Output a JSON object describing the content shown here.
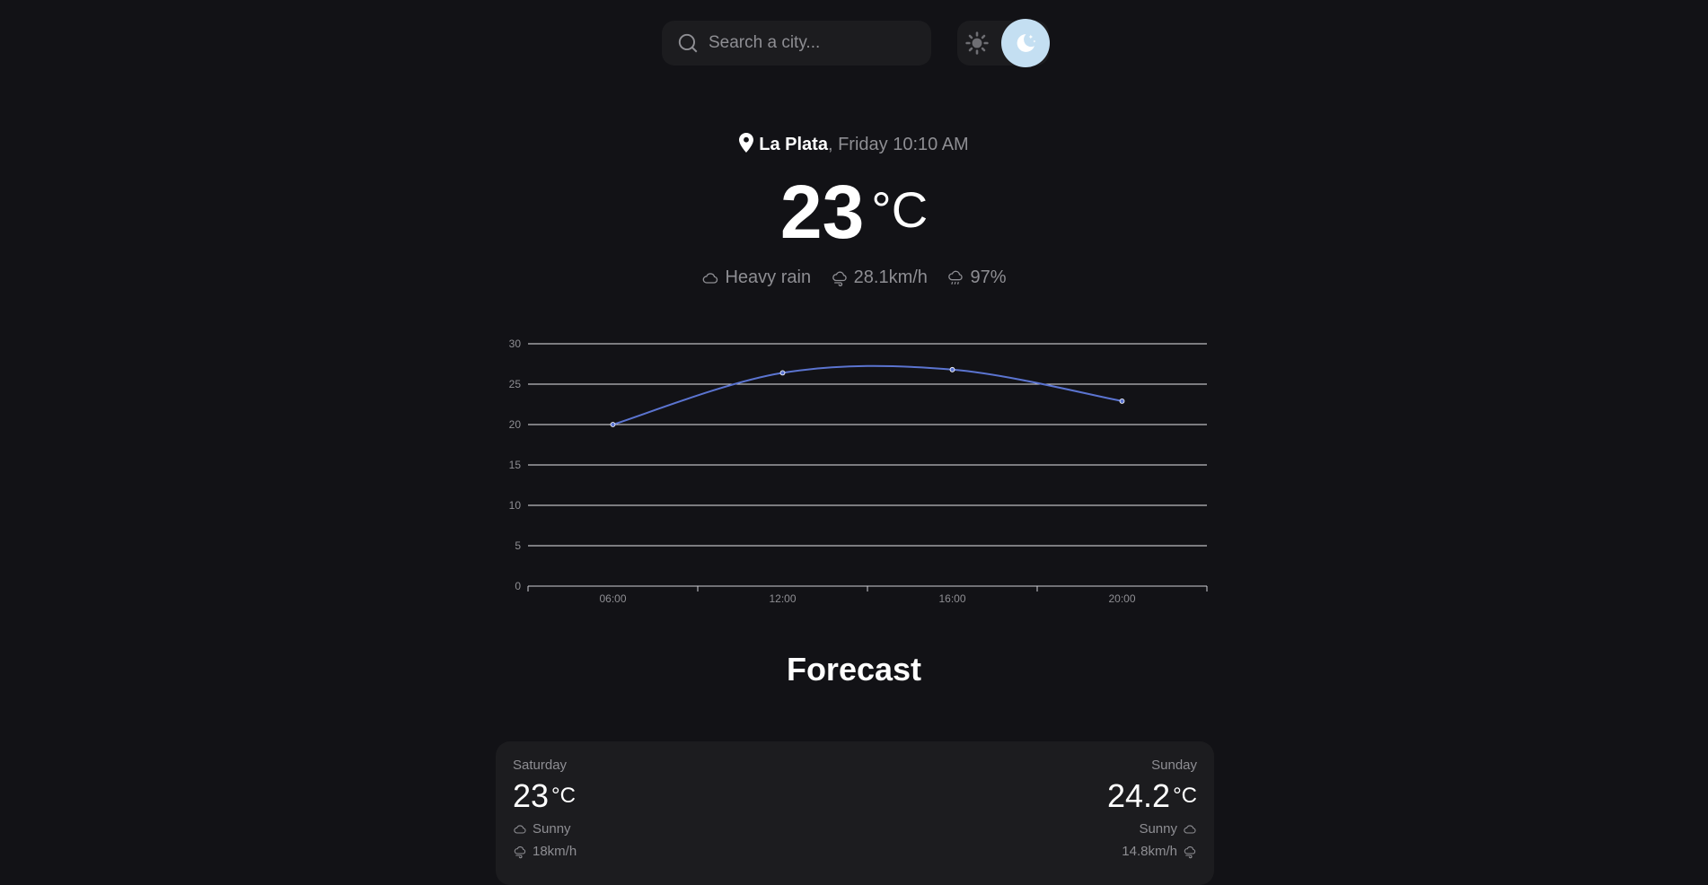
{
  "search": {
    "placeholder": "Search a city..."
  },
  "theme": {
    "current": "dark"
  },
  "current": {
    "city": "La Plata",
    "datetime": ", Friday 10:10 AM",
    "temperature": "23",
    "unit": "°C",
    "condition": "Heavy rain",
    "wind": "28.1km/h",
    "humidity": "97%"
  },
  "chart_data": {
    "type": "line",
    "x": [
      "06:00",
      "12:00",
      "16:00",
      "20:00"
    ],
    "series": [
      {
        "values": [
          20,
          26.4,
          26.8,
          22.9
        ]
      }
    ],
    "ylim": [
      0,
      30
    ],
    "yticks": [
      0,
      5,
      10,
      15,
      20,
      25,
      30
    ],
    "grid": true,
    "line_color": "#5b74d0"
  },
  "forecast": {
    "title": "Forecast",
    "days": [
      {
        "name": "Saturday",
        "temp": "23",
        "unit": "°C",
        "condition": "Sunny",
        "wind": "18km/h"
      },
      {
        "name": "Sunday",
        "temp": "24.2",
        "unit": "°C",
        "condition": "Sunny",
        "wind": "14.8km/h"
      }
    ]
  }
}
